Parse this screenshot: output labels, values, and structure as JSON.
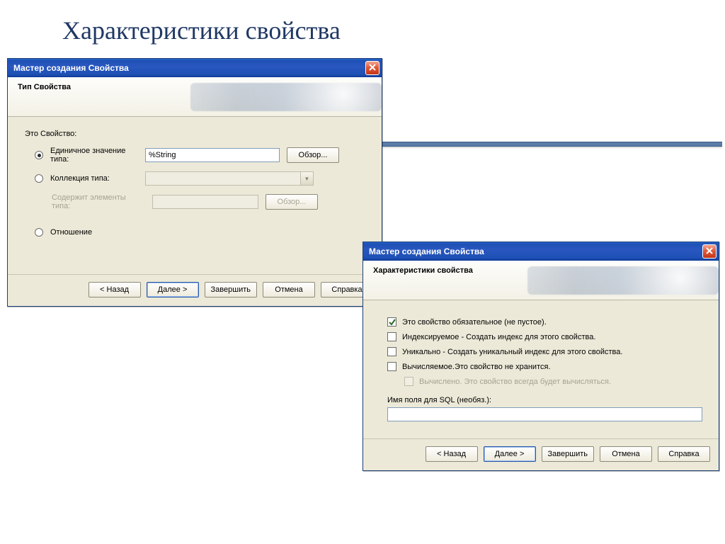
{
  "slide": {
    "title": "Характеристики свойства"
  },
  "win1": {
    "title": "Мастер создания Свойства",
    "header": "Тип Свойства",
    "section_label": "Это Свойство:",
    "radios": {
      "single": "Единичное значение типа:",
      "collection": "Коллекция типа:",
      "contains": "Содержит элементы типа:",
      "relation": "Отношение"
    },
    "type_value": "%String",
    "browse": "Обзор...",
    "browse_disabled": "Обзор...",
    "buttons": {
      "back": "< Назад",
      "next": "Далее >",
      "finish": "Завершить",
      "cancel": "Отмена",
      "help": "Справка"
    }
  },
  "win2": {
    "title": "Мастер создания Свойства",
    "header": "Характеристики свойства",
    "checks": {
      "required": "Это свойство обязательное (не пустое).",
      "indexed": "Индексируемое - Создать индекс для этого свойства.",
      "unique": "Уникально - Создать уникальный индекс для этого свойства.",
      "computed": "Вычисляемое.Это свойство не хранится.",
      "computed_always": "Вычислено. Это свойство всегда будет вычисляться."
    },
    "sql_label": "Имя поля для SQL (необяз.):",
    "sql_value": "",
    "buttons": {
      "back": "< Назад",
      "next": "Далее >",
      "finish": "Завершить",
      "cancel": "Отмена",
      "help": "Справка"
    }
  }
}
